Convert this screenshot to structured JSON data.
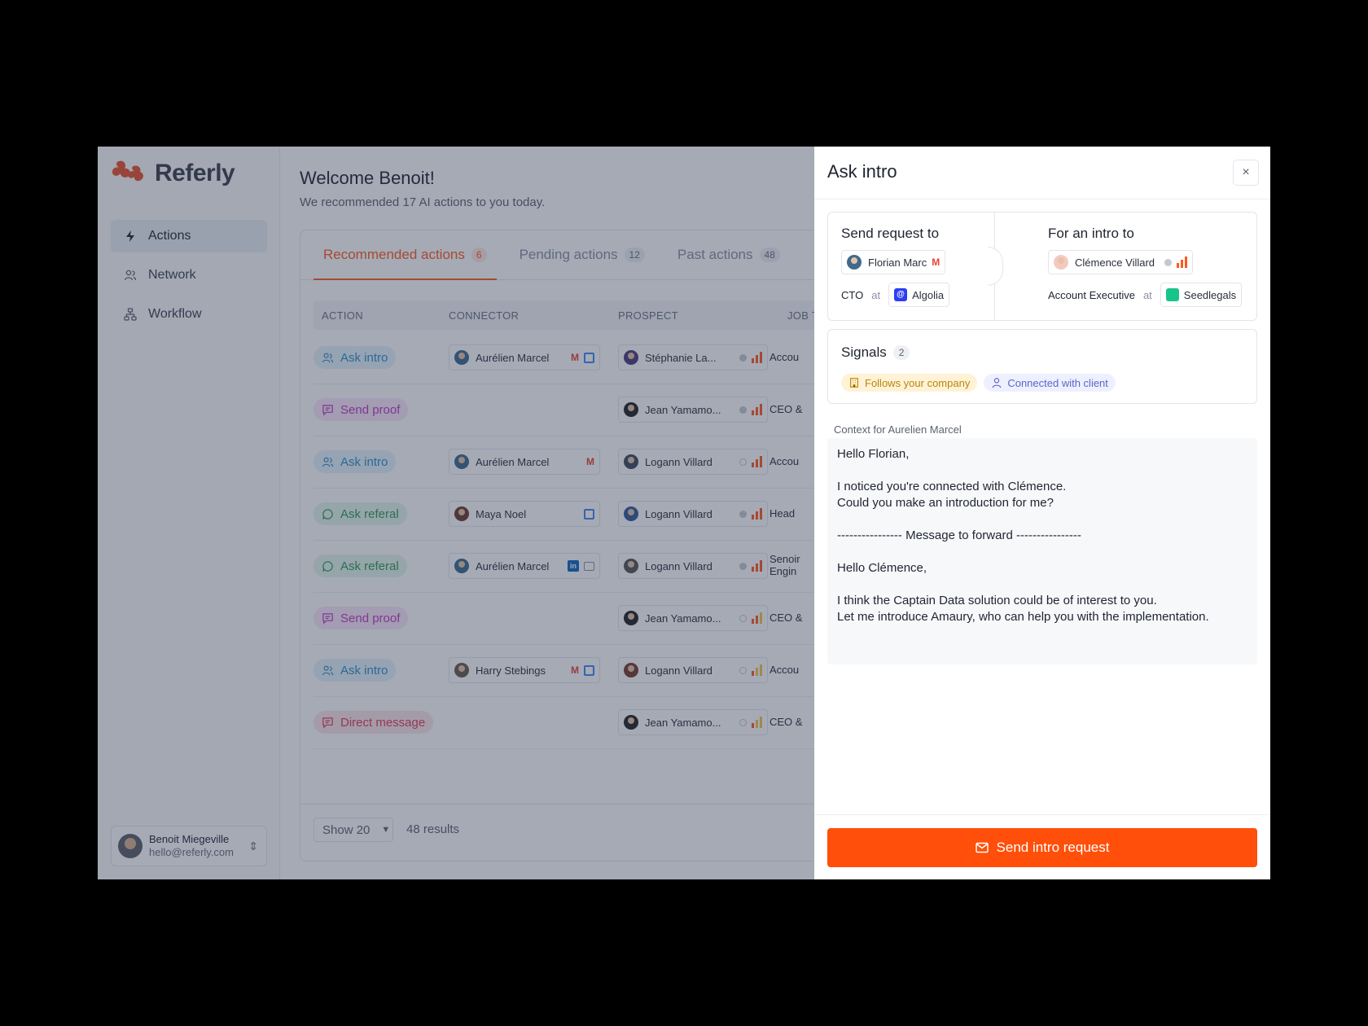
{
  "app": {
    "name": "Referly"
  },
  "sidebar": {
    "items": [
      {
        "label": "Actions",
        "icon": "bolt-icon",
        "active": true
      },
      {
        "label": "Network",
        "icon": "users-icon"
      },
      {
        "label": "Workflow",
        "icon": "workflow-icon"
      }
    ],
    "user": {
      "name": "Benoit Miegeville",
      "email": "hello@referly.com"
    }
  },
  "main": {
    "welcome": "Welcome Benoit!",
    "subtitle": "We recommended 17 AI actions to you today.",
    "tabs": [
      {
        "label": "Recommended actions",
        "count": "6"
      },
      {
        "label": "Pending actions",
        "count": "12"
      },
      {
        "label": "Past actions",
        "count": "48"
      }
    ],
    "columns": [
      "ACTION",
      "CONNECTOR",
      "PROSPECT",
      "JOB T"
    ],
    "rows": [
      {
        "action": "Ask intro",
        "connector": "Aurélien Marcel",
        "prospect": "Stéphanie La...",
        "job": "Accou"
      },
      {
        "action": "Send proof",
        "connector": "",
        "prospect": "Jean Yamamo...",
        "job": "CEO &"
      },
      {
        "action": "Ask intro",
        "connector": "Aurélien Marcel",
        "prospect": "Logann Villard",
        "job": "Accou"
      },
      {
        "action": "Ask referal",
        "connector": "Maya Noel",
        "prospect": "Logann Villard",
        "job": "Head"
      },
      {
        "action": "Ask referal",
        "connector": "Aurélien Marcel",
        "prospect": "Logann Villard",
        "job": "Senoir\nEngin"
      },
      {
        "action": "Send proof",
        "connector": "",
        "prospect": "Jean Yamamo...",
        "job": "CEO &"
      },
      {
        "action": "Ask intro",
        "connector": "Harry Stebings",
        "prospect": "Logann Villard",
        "job": "Accou"
      },
      {
        "action": "Direct message",
        "connector": "",
        "prospect": "Jean Yamamo...",
        "job": "CEO &"
      }
    ],
    "footer": {
      "show": "Show 20",
      "results": "48 results"
    }
  },
  "drawer": {
    "title": "Ask intro",
    "close": "×",
    "send_to": {
      "label": "Send request to",
      "name": "Florian Marc",
      "role": "CTO",
      "at": "at",
      "company": "Algolia"
    },
    "intro_to": {
      "label": "For an intro to",
      "name": "Clémence Villard",
      "role": "Account Executive",
      "at": "at",
      "company": "Seedlegals"
    },
    "signals": {
      "title": "Signals",
      "count": "2",
      "tags": [
        "Follows your company",
        "Connected with client"
      ]
    },
    "context_label": "Context for Aurelien Marcel",
    "message": "Hello Florian,\n\nI noticed you're connected with Clémence.\nCould you make an introduction for me?\n\n---------------- Message to forward ----------------\n\nHello Clémence,\n\nI think the Captain Data solution could be of interest to you.\nLet me introduce Amaury, who can help you with the implementation.",
    "send_button": "Send intro request"
  },
  "colors": {
    "accent": "#ff4f0a",
    "overlay": "#28344e"
  }
}
